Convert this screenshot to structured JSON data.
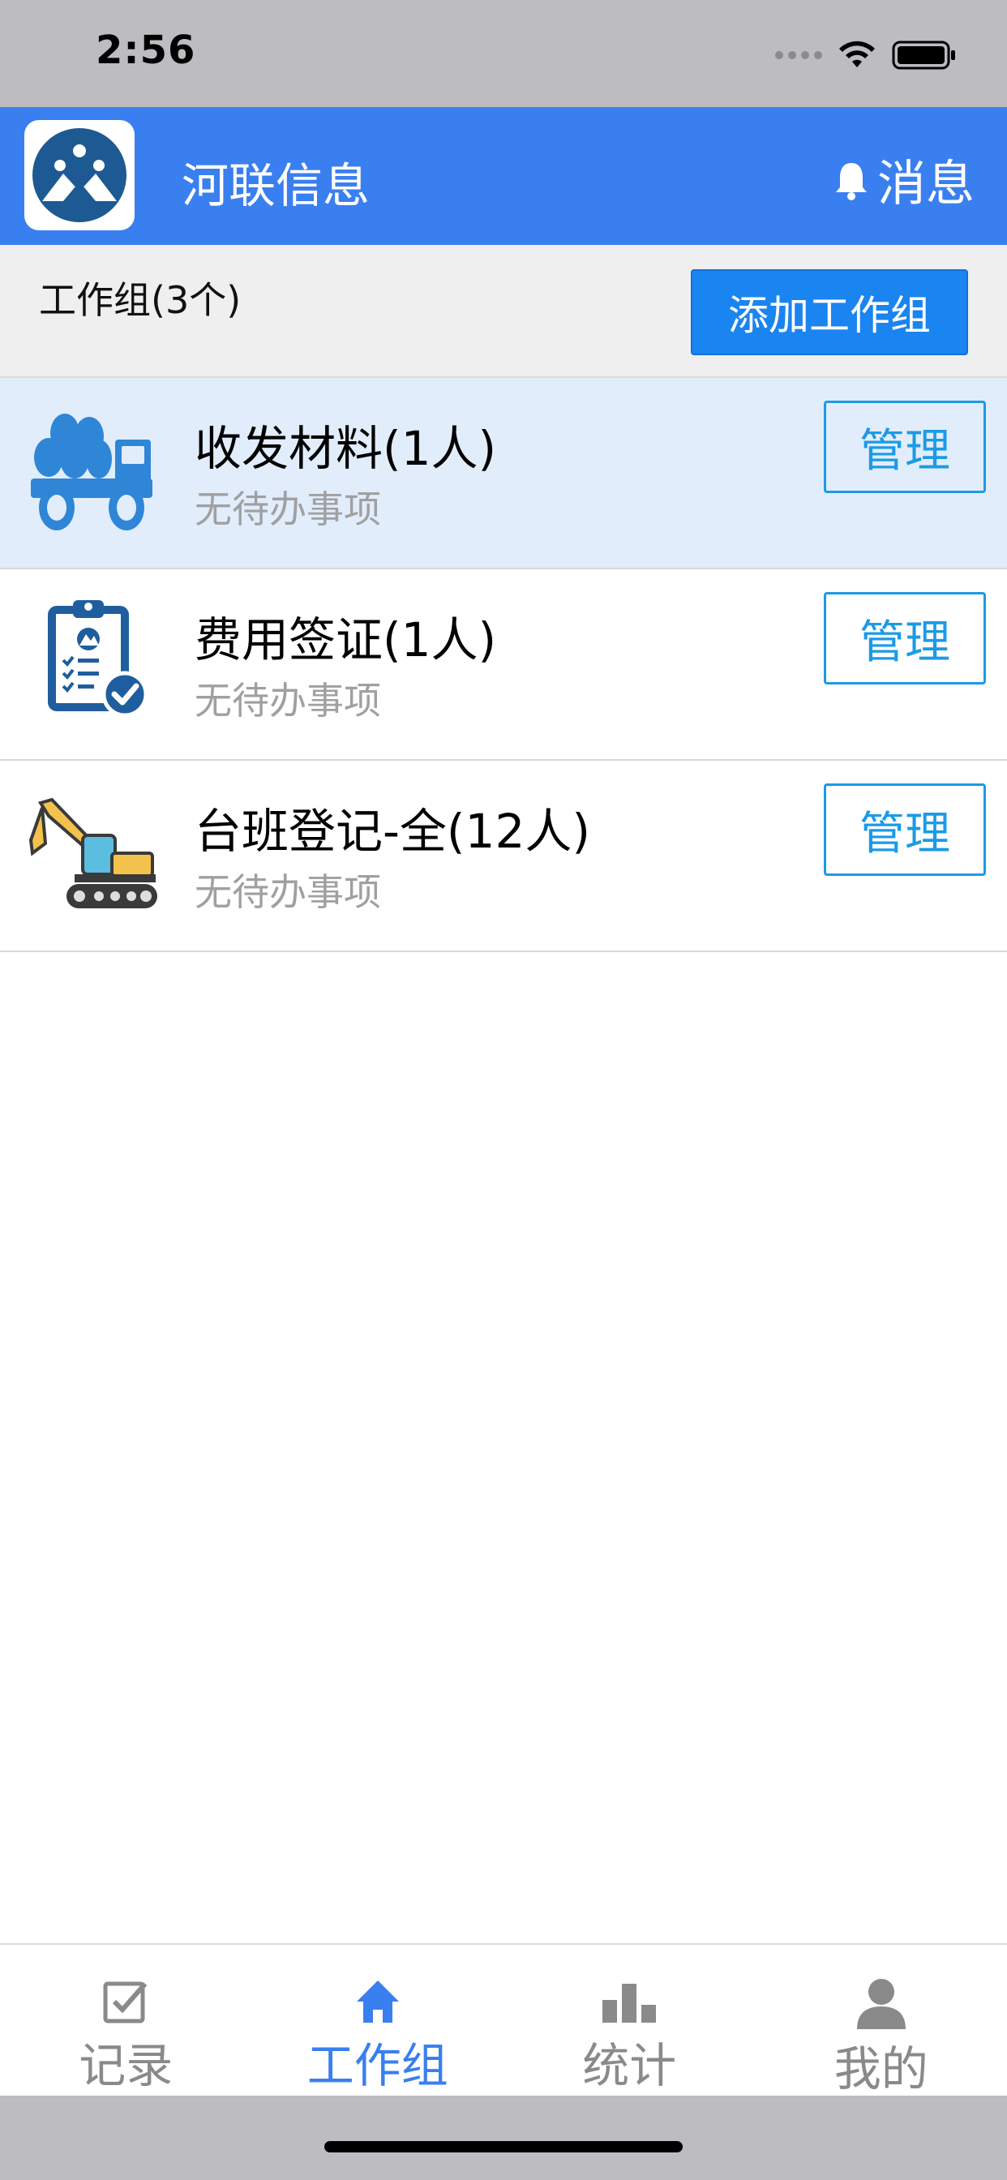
{
  "status_bar": {
    "time": "2:56"
  },
  "header": {
    "title": "河联信息",
    "message_label": "消息"
  },
  "group_bar": {
    "count_label": "工作组(3个)",
    "add_button": "添加工作组"
  },
  "groups": [
    {
      "title": "收发材料(1人)",
      "subtitle": "无待办事项",
      "manage": "管理",
      "icon": "truck-icon"
    },
    {
      "title": "费用签证(1人)",
      "subtitle": "无待办事项",
      "manage": "管理",
      "icon": "clipboard-check-icon"
    },
    {
      "title": "台班登记-全(12人)",
      "subtitle": "无待办事项",
      "manage": "管理",
      "icon": "excavator-icon"
    }
  ],
  "tabs": [
    {
      "label": "记录",
      "icon": "checkbox-icon"
    },
    {
      "label": "工作组",
      "icon": "home-icon",
      "active": true
    },
    {
      "label": "统计",
      "icon": "bar-chart-icon"
    },
    {
      "label": "我的",
      "icon": "person-icon"
    }
  ],
  "colors": {
    "primary": "#3a7ff0",
    "button": "#1a84f0",
    "manage": "#1c9ae6",
    "active_row": "#e2edfc"
  }
}
